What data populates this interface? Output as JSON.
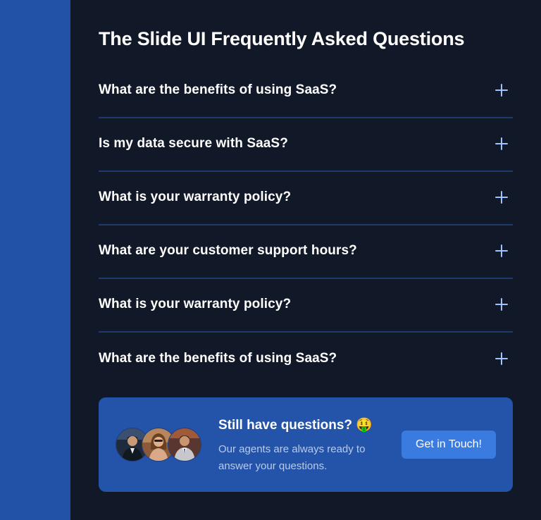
{
  "page_title": "The Slide UI Frequently Asked Questions",
  "faq": {
    "items": [
      {
        "question": "What are the benefits of using SaaS?",
        "icon": "plus-icon"
      },
      {
        "question": "Is my data secure with SaaS?",
        "icon": "plus-icon"
      },
      {
        "question": "What is your warranty policy?",
        "icon": "plus-icon"
      },
      {
        "question": "What are your customer support hours?",
        "icon": "plus-icon"
      },
      {
        "question": "What is your warranty policy?",
        "icon": "plus-icon"
      },
      {
        "question": "What are the benefits of using SaaS?",
        "icon": "plus-icon"
      }
    ]
  },
  "cta": {
    "title": "Still have questions? 🤑",
    "description": "Our agents are always ready to answer your questions.",
    "button_label": "Get in Touch!",
    "avatars": [
      "avatar-1",
      "avatar-2",
      "avatar-3"
    ]
  },
  "colors": {
    "background": "#111827",
    "rail": "#2152a8",
    "divider": "#1e3a6e",
    "card": "#2454a9",
    "button": "#3a7be0",
    "icon": "#9fc4ff"
  }
}
